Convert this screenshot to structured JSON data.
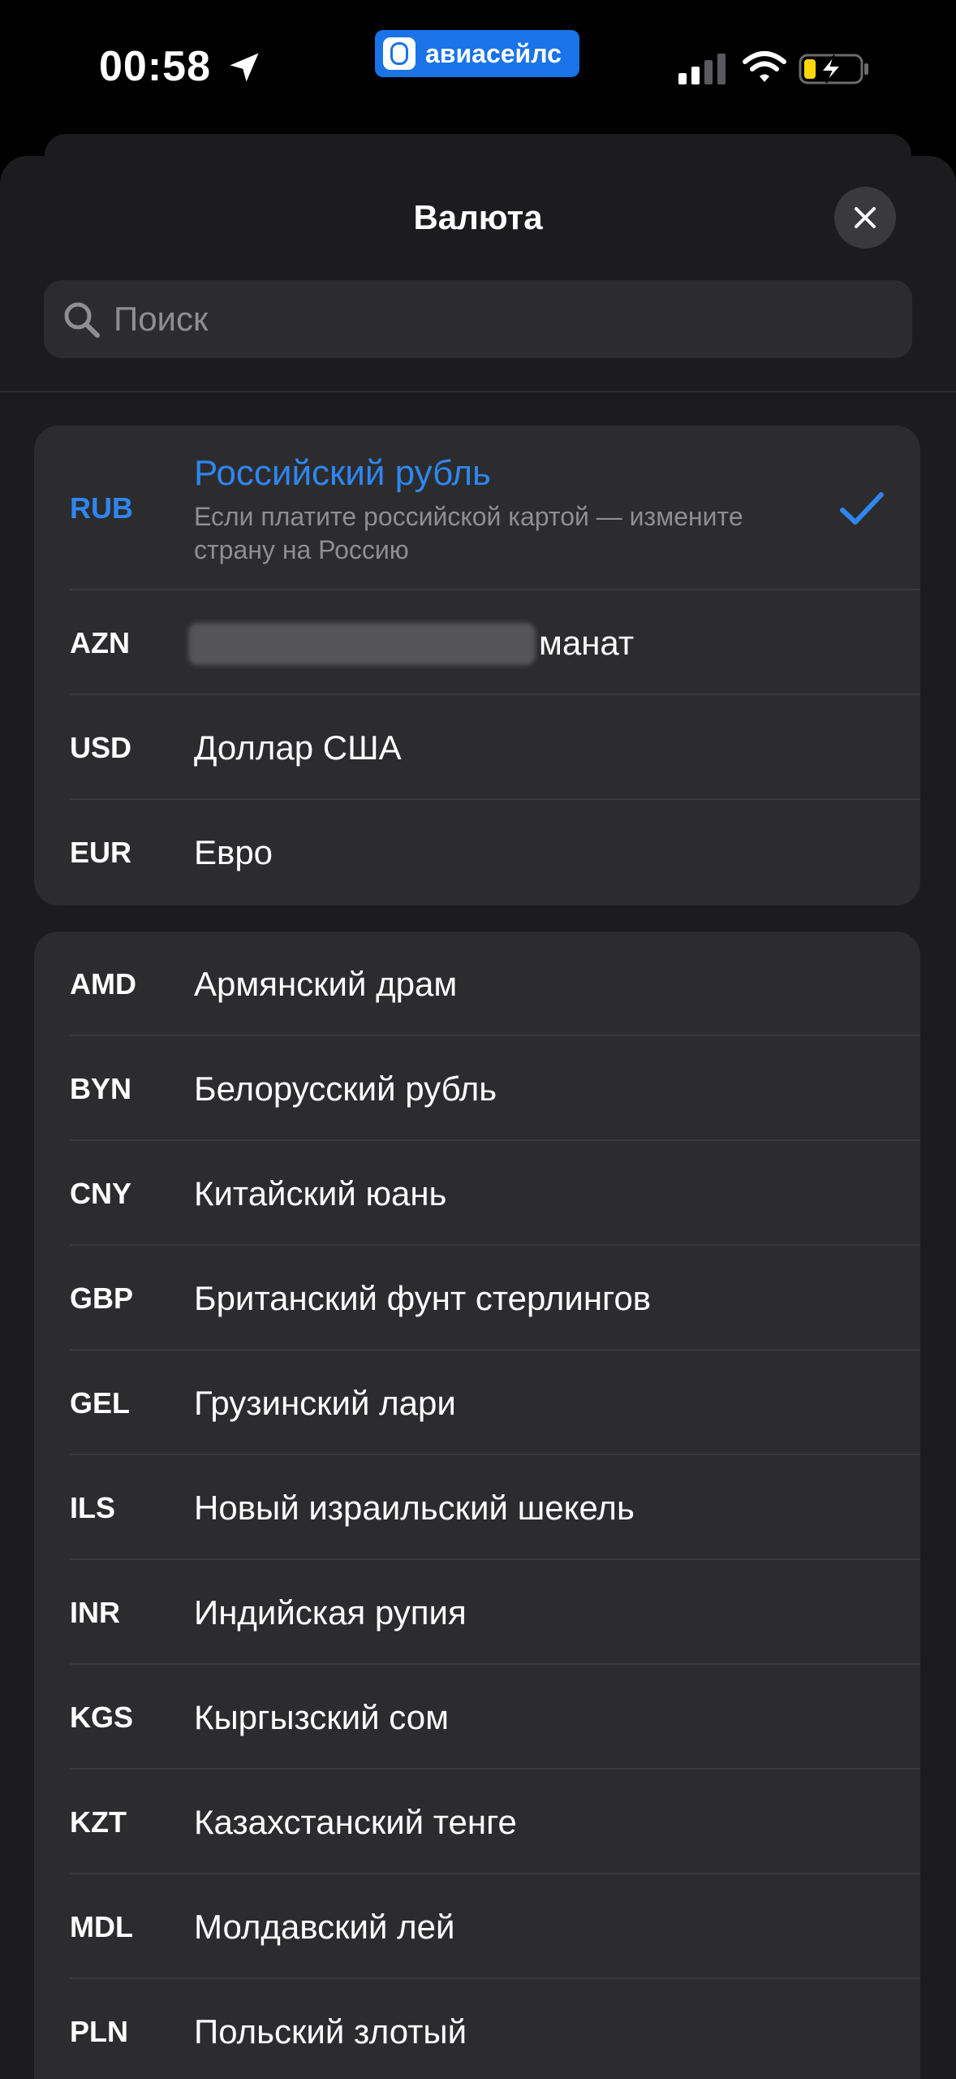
{
  "status_bar": {
    "time": "00:58",
    "app_name": "авиасейлс",
    "battery_accent": "#ffd60a"
  },
  "sheet": {
    "title": "Валюта",
    "search_placeholder": "Поиск",
    "accent_color": "#2f86f0"
  },
  "groups": {
    "top": [
      {
        "code": "RUB",
        "name": "Российский рубль",
        "hint": "Если платите российской картой — измените страну на Россию",
        "selected": true
      },
      {
        "code": "AZN",
        "name": "манат",
        "redacted_prefix": true
      },
      {
        "code": "USD",
        "name": "Доллар США"
      },
      {
        "code": "EUR",
        "name": "Евро"
      }
    ],
    "bottom": [
      {
        "code": "AMD",
        "name": "Армянский драм"
      },
      {
        "code": "BYN",
        "name": "Белорусский рубль"
      },
      {
        "code": "CNY",
        "name": "Китайский юань"
      },
      {
        "code": "GBP",
        "name": "Британский фунт стерлингов"
      },
      {
        "code": "GEL",
        "name": "Грузинский лари"
      },
      {
        "code": "ILS",
        "name": "Новый израильский шекель"
      },
      {
        "code": "INR",
        "name": "Индийская рупия"
      },
      {
        "code": "KGS",
        "name": "Кыргызский сом"
      },
      {
        "code": "KZT",
        "name": "Казахстанский тенге"
      },
      {
        "code": "MDL",
        "name": "Молдавский лей"
      },
      {
        "code": "PLN",
        "name": "Польский злотый"
      }
    ]
  }
}
